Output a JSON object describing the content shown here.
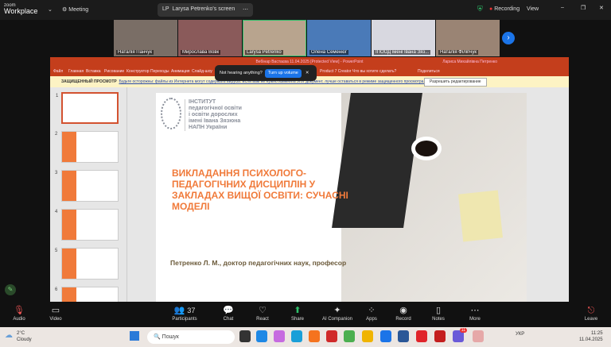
{
  "zoom": {
    "brand_small": "zoom",
    "brand": "Workplace",
    "meeting_label": "Meeting",
    "share_initials": "LP",
    "share_label": "Larysa Petrenko's screen",
    "recording": "Recording",
    "view": "View"
  },
  "participants": [
    {
      "name": "Наталія Панчук"
    },
    {
      "name": "Мирослава Вовк"
    },
    {
      "name": "Larysa Petrenko",
      "active": true
    },
    {
      "name": "Олена Семенюг"
    },
    {
      "name": "ІПООД імені Івана Зяз..."
    },
    {
      "name": "Наталія Філіпчук"
    }
  ],
  "ppt": {
    "window_title": "Вебінар Вастаєва 11.04.2025 [Protected View] - PowerPoint",
    "user": "Лариса Михайлівна Петренко",
    "tabs": [
      "Файл",
      "Главная",
      "Вставка",
      "Рисование",
      "Конструктор",
      "Переходы",
      "Анимация",
      "Слайд-шоу",
      "",
      "",
      "",
      "Acrobat",
      "Nitro Pro",
      "Foxit PDF",
      "Product 7 Creator"
    ],
    "tell_me": "Что вы хотите сделать?",
    "share": "Поделиться",
    "protected_label": "ЗАЩИЩЕННЫЙ ПРОСМОТР",
    "protected_msg": "Будьте осторожны: файлы из Интернета могут содержать вирусы. Если вам не нужно изменять этот документ, лучше оставаться в режиме защищенного просмотра.",
    "enable_edit": "Разрешить редактирование",
    "thumb_numbers": [
      "1",
      "2",
      "3",
      "4",
      "5",
      "6"
    ]
  },
  "toast": {
    "text": "Not hearing anything?",
    "button": "Turn up volume"
  },
  "slide": {
    "institute": [
      "ІНСТИТУТ",
      "педагогічної освіти",
      "і освіти дорослих",
      "імені Івана Зязюна",
      "НАПН України"
    ],
    "title": "ВИКЛАДАННЯ ПСИХОЛОГО-ПЕДАГОГІЧНИХ ДИСЦИПЛІН У ЗАКЛАДАХ ВИЩОЇ ОСВІТИ: СУЧАСНІ МОДЕЛІ",
    "author": "Петренко Л. М., доктор педагогічних наук, професор",
    "title_color": "#f07a3a"
  },
  "toolbar": {
    "audio": "Audio",
    "video": "Video",
    "participants": "Participants",
    "participants_count": "37",
    "chat": "Chat",
    "react": "React",
    "share": "Share",
    "ai": "AI Companion",
    "apps": "Apps",
    "record": "Record",
    "notes": "Notes",
    "more": "More",
    "leave": "Leave"
  },
  "taskbar": {
    "temp": "2°C",
    "weather": "Cloudy",
    "search": "Пошук",
    "lang": "УКР",
    "time": "11:25",
    "date": "11.04.2025",
    "badge": "11"
  }
}
